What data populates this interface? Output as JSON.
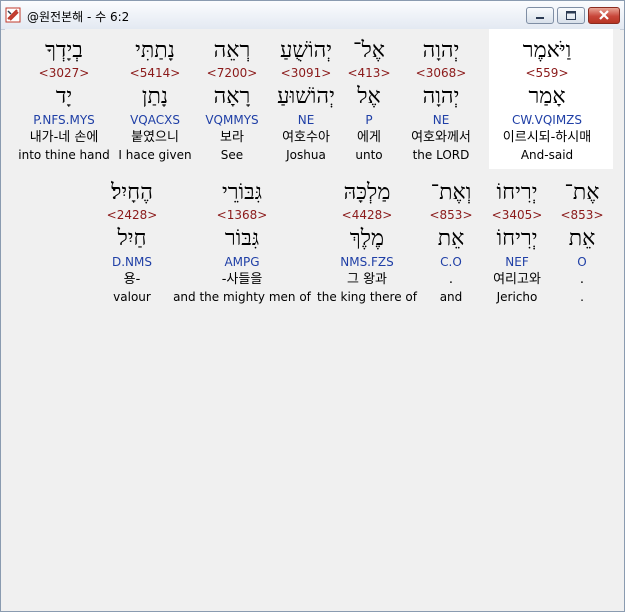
{
  "window": {
    "title": "@원전본해 - 수 6:2"
  },
  "rows": [
    {
      "words": [
        {
          "hebrew": "וַיֹּאמֶר",
          "strong": "<559>",
          "lemma": "אָמַר",
          "morph": "CW.VQIMZS",
          "korean": "이르시되-하시매",
          "english": "And-said",
          "center": 542
        },
        {
          "hebrew": "יְהוָה",
          "strong": "<3068>",
          "lemma": "יְהוָה",
          "morph": "NE",
          "korean": "여호와께서",
          "english": "the LORD",
          "center": 436
        },
        {
          "hebrew": "אֶל־",
          "strong": "<413>",
          "lemma": "אֶל",
          "morph": "P",
          "korean": "에게",
          "english": "unto",
          "center": 364
        },
        {
          "hebrew": "יְהוֹשֻׁעַ",
          "strong": "<3091>",
          "lemma": "יְהוֹשׁוּעַ",
          "morph": "NE",
          "korean": "여호수아",
          "english": "Joshua",
          "center": 301
        },
        {
          "hebrew": "רְאֵה",
          "strong": "<7200>",
          "lemma": "רָאָה",
          "morph": "VQMMYS",
          "korean": "보라",
          "english": "See",
          "center": 227
        },
        {
          "hebrew": "נָתַתִּי",
          "strong": "<5414>",
          "lemma": "נָתַן",
          "morph": "VQACXS",
          "korean": "붙였으니",
          "english": "I hace given",
          "center": 150
        },
        {
          "hebrew": "בְיָדְךָ",
          "strong": "<3027>",
          "lemma": "יָד",
          "morph": "P.NFS.MYS",
          "korean": "내가-네 손에",
          "english": "into thine hand",
          "center": 59
        }
      ]
    },
    {
      "words": [
        {
          "hebrew": "אֶת־",
          "strong": "<853>",
          "lemma": "אֵת",
          "morph": "O",
          "korean": ".",
          "english": ".",
          "center": 577
        },
        {
          "hebrew": "יְרִיחוֹ",
          "strong": "<3405>",
          "lemma": "יְרִיחוֹ",
          "morph": "NEF",
          "korean": "여리고와",
          "english": "Jericho",
          "center": 512
        },
        {
          "hebrew": "וְאֶת־",
          "strong": "<853>",
          "lemma": "אֵת",
          "morph": "C.O",
          "korean": ".",
          "english": "and",
          "center": 446
        },
        {
          "hebrew": "מַלְכָּהּ",
          "strong": "<4428>",
          "lemma": "מֶלֶךְ",
          "morph": "NMS.FZS",
          "korean": "그 왕과",
          "english": "the king there of",
          "center": 362
        },
        {
          "hebrew": "גִּבּוֹרֵי",
          "strong": "<1368>",
          "lemma": "גִּבּוֹר",
          "morph": "AMPG",
          "korean": "-사들을",
          "english": "and the mighty men of",
          "center": 237
        },
        {
          "hebrew": "הֶחָיִל׃",
          "strong": "<2428>",
          "lemma": "חַיִל",
          "morph": "D.NMS",
          "korean": "용-",
          "english": "valour",
          "center": 127
        }
      ]
    }
  ]
}
